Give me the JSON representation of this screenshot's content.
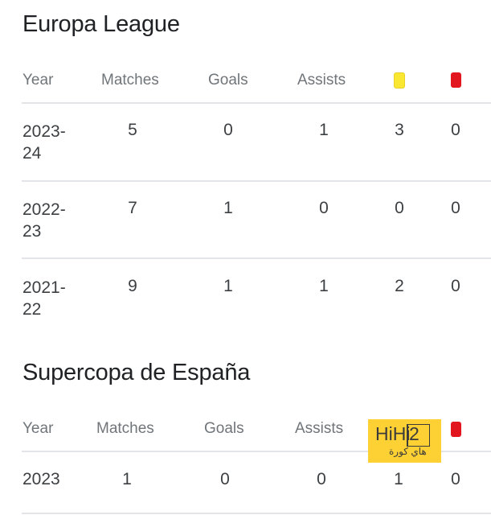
{
  "sections": [
    {
      "title": "Europa League",
      "headers": {
        "year": "Year",
        "matches": "Matches",
        "goals": "Goals",
        "assists": "Assists",
        "yellow_card": "yellow-card-icon",
        "red_card": "red-card-icon"
      },
      "rows": [
        {
          "year_line1": "2023-",
          "year_line2": "24",
          "matches": "5",
          "goals": "0",
          "assists": "1",
          "yellow": "3",
          "red": "0"
        },
        {
          "year_line1": "2022-",
          "year_line2": "23",
          "matches": "7",
          "goals": "1",
          "assists": "0",
          "yellow": "0",
          "red": "0"
        },
        {
          "year_line1": "2021-",
          "year_line2": "22",
          "matches": "9",
          "goals": "1",
          "assists": "1",
          "yellow": "2",
          "red": "0"
        }
      ]
    },
    {
      "title": "Supercopa de España",
      "headers": {
        "year": "Year",
        "matches": "Matches",
        "goals": "Goals",
        "assists": "Assists",
        "red_card": "red-card-icon"
      },
      "rows": [
        {
          "year": "2023",
          "matches": "1",
          "goals": "0",
          "assists": "0",
          "yellow": "1",
          "red": "0"
        }
      ]
    }
  ],
  "colors": {
    "yellow_card": "#f9e732",
    "red_card": "#e2161f",
    "watermark_bg": "#fdd033"
  },
  "watermark": {
    "brand": "HiHi",
    "digit": "2",
    "arabic": "هاي كورة"
  }
}
